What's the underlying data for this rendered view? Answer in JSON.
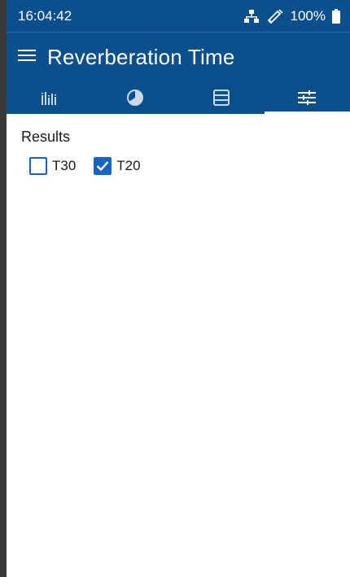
{
  "status_bar": {
    "time": "16:04:42",
    "battery": "100%",
    "icons": [
      "network-icon",
      "probe-icon",
      "battery-icon"
    ]
  },
  "header": {
    "title": "Reverberation Time",
    "menu_icon": "menu-icon"
  },
  "tabs": [
    {
      "icon": "spectrum-bars-icon",
      "active": false
    },
    {
      "icon": "contrast-circle-icon",
      "active": false
    },
    {
      "icon": "table-list-icon",
      "active": false
    },
    {
      "icon": "sliders-icon",
      "active": true
    }
  ],
  "content": {
    "section_label": "Results",
    "options": [
      {
        "label": "T30",
        "checked": false
      },
      {
        "label": "T20",
        "checked": true
      }
    ]
  },
  "colors": {
    "header_bg": "#0b4f8d",
    "accent": "#1565c0",
    "text": "#1a1a1a"
  }
}
